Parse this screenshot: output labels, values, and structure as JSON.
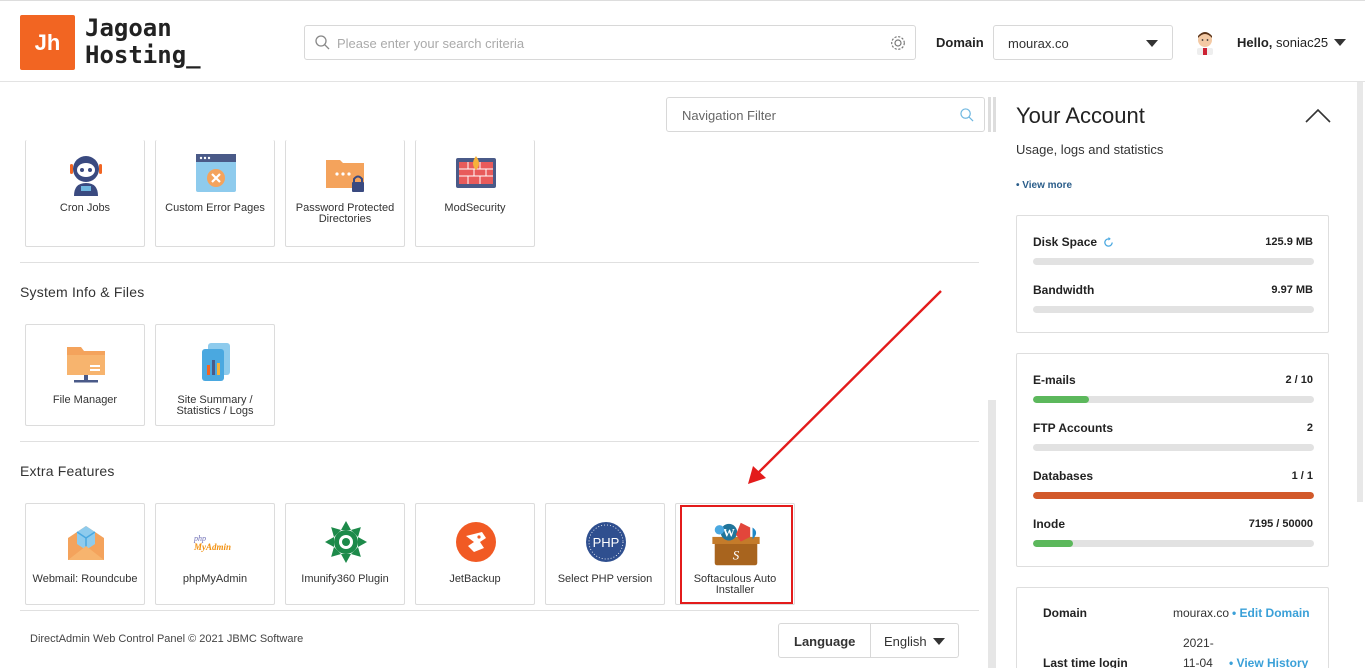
{
  "header": {
    "logo_mark": "Jh",
    "logo_line1": "Jagoan",
    "logo_line2": "Hosting_",
    "search_placeholder": "Please enter your search criteria",
    "domain_label": "Domain",
    "domain_value": "mourax.co",
    "hello_prefix": "Hello,",
    "username": "soniac25"
  },
  "nav_filter": {
    "placeholder": "Navigation Filter"
  },
  "top_tiles": [
    {
      "label": "Cron Jobs",
      "icon": "robot-icon"
    },
    {
      "label": "Custom Error Pages",
      "icon": "error-page-icon"
    },
    {
      "label": "Password Protected Directories",
      "icon": "locked-folder-icon"
    },
    {
      "label": "ModSecurity",
      "icon": "firewall-icon"
    }
  ],
  "sections": [
    {
      "title": "System Info & Files",
      "tiles": [
        {
          "label": "File Manager",
          "icon": "folder-icon"
        },
        {
          "label": "Site Summary / Statistics / Logs",
          "icon": "statistics-icon"
        }
      ]
    },
    {
      "title": "Extra Features",
      "tiles": [
        {
          "label": "Webmail: Roundcube",
          "icon": "webmail-icon"
        },
        {
          "label": "phpMyAdmin",
          "icon": "phpmyadmin-icon",
          "logo_line1": "php",
          "logo_line2": "MyAdmin"
        },
        {
          "label": "Imunify360 Plugin",
          "icon": "imunify-icon"
        },
        {
          "label": "JetBackup",
          "icon": "jetbackup-icon"
        },
        {
          "label": "Select PHP version",
          "icon": "php-icon",
          "logo_text": "PHP"
        },
        {
          "label": "Softaculous Auto Installer",
          "icon": "softaculous-icon"
        }
      ]
    }
  ],
  "footer": {
    "copyright": "DirectAdmin Web Control Panel © 2021 JBMC Software",
    "language_label": "Language",
    "language_value": "English"
  },
  "account": {
    "title": "Your Account",
    "subtitle": "Usage, logs and statistics",
    "view_more": "• View more",
    "usage": [
      {
        "name": "Disk Space",
        "value": "125.9 MB",
        "fill": 0.0
      },
      {
        "name": "Bandwidth",
        "value": "9.97 MB",
        "fill": 0.0
      }
    ],
    "limits": [
      {
        "name": "E-mails",
        "value": "2 / 10",
        "fill": 0.2,
        "color": "#5cb85c"
      },
      {
        "name": "FTP Accounts",
        "value": "2",
        "fill": 0.0,
        "color": "#5cb85c"
      },
      {
        "name": "Databases",
        "value": "1 / 1",
        "fill": 1.0,
        "color": "#d2592a"
      },
      {
        "name": "Inode",
        "value": "7195 / 50000",
        "fill": 0.144,
        "color": "#5cb85c"
      }
    ],
    "domain_info": {
      "domain_label": "Domain",
      "domain_value": "mourax.co",
      "edit_link": "• Edit Domain",
      "last_login_label": "Last time login",
      "last_login_value_line1": "2021-",
      "last_login_value_line2": "11-04",
      "history_link": "• View History"
    }
  },
  "colors": {
    "brand": "#f26522",
    "link": "#3aa0d8",
    "highlight": "#e31b1b"
  }
}
